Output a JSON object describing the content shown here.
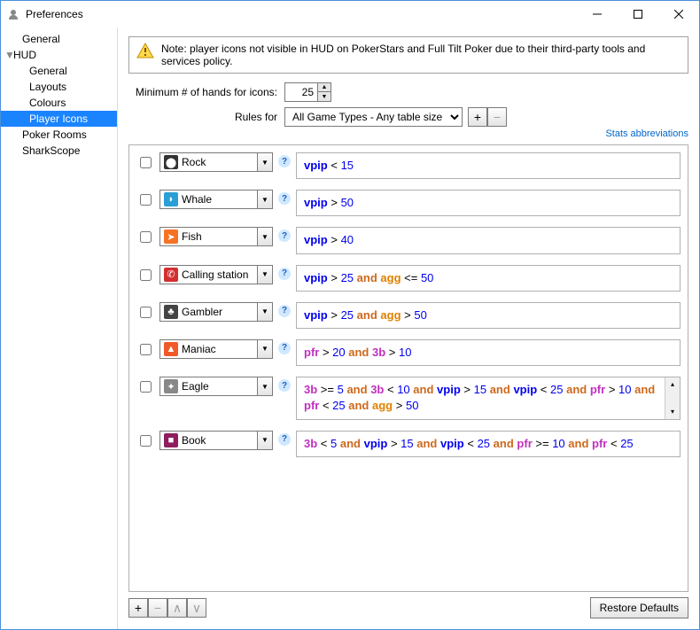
{
  "window": {
    "title": "Preferences"
  },
  "sidebar": {
    "items": [
      {
        "label": "General"
      },
      {
        "label": "HUD"
      },
      {
        "label": "General"
      },
      {
        "label": "Layouts"
      },
      {
        "label": "Colours"
      },
      {
        "label": "Player Icons"
      },
      {
        "label": "Poker Rooms"
      },
      {
        "label": "SharkScope"
      }
    ]
  },
  "note": "Note: player icons not visible in HUD on PokerStars and Full Tilt Poker due to their third-party tools and services policy.",
  "min_hands": {
    "label": "Minimum # of hands for icons:",
    "value": "25"
  },
  "rules_for": {
    "label": "Rules for",
    "selected": "All Game Types - Any table size"
  },
  "stats_link": "Stats abbreviations",
  "rules": [
    {
      "name": "Rock",
      "icon_bg": "#333333",
      "icon_glyph": "⬤"
    },
    {
      "name": "Whale",
      "icon_bg": "#2a9fd6",
      "icon_glyph": "◗"
    },
    {
      "name": "Fish",
      "icon_bg": "#f57224",
      "icon_glyph": "➤"
    },
    {
      "name": "Calling station",
      "icon_bg": "#d32f2f",
      "icon_glyph": "✆"
    },
    {
      "name": "Gambler",
      "icon_bg": "#444444",
      "icon_glyph": "♣"
    },
    {
      "name": "Maniac",
      "icon_bg": "#f05a28",
      "icon_glyph": "▲"
    },
    {
      "name": "Eagle",
      "icon_bg": "#888888",
      "icon_glyph": "✦"
    },
    {
      "name": "Book",
      "icon_bg": "#8e1e5f",
      "icon_glyph": "■"
    }
  ],
  "expressions": {
    "rock": [
      [
        "var",
        "vpip"
      ],
      [
        "op",
        " < "
      ],
      [
        "num",
        "15"
      ]
    ],
    "whale": [
      [
        "var",
        "vpip"
      ],
      [
        "op",
        " > "
      ],
      [
        "num",
        "50"
      ]
    ],
    "fish": [
      [
        "var",
        "vpip"
      ],
      [
        "op",
        " > "
      ],
      [
        "num",
        "40"
      ]
    ],
    "calling": [
      [
        "var",
        "vpip"
      ],
      [
        "op",
        " > "
      ],
      [
        "num",
        "25"
      ],
      [
        "txt",
        " "
      ],
      [
        "kw",
        "and"
      ],
      [
        "txt",
        " "
      ],
      [
        "agg",
        "agg"
      ],
      [
        "op",
        " <= "
      ],
      [
        "num",
        "50"
      ]
    ],
    "gambler": [
      [
        "var",
        "vpip"
      ],
      [
        "op",
        " > "
      ],
      [
        "num",
        "25"
      ],
      [
        "txt",
        " "
      ],
      [
        "kw",
        "and"
      ],
      [
        "txt",
        " "
      ],
      [
        "agg",
        "agg"
      ],
      [
        "op",
        " > "
      ],
      [
        "num",
        "50"
      ]
    ],
    "maniac": [
      [
        "pfr",
        "pfr"
      ],
      [
        "op",
        " > "
      ],
      [
        "num",
        "20"
      ],
      [
        "txt",
        " "
      ],
      [
        "kw",
        "and"
      ],
      [
        "txt",
        " "
      ],
      [
        "3b",
        "3b"
      ],
      [
        "op",
        " > "
      ],
      [
        "num",
        "10"
      ]
    ],
    "eagle": [
      [
        "3b",
        "3b"
      ],
      [
        "op",
        " >= "
      ],
      [
        "num",
        "5"
      ],
      [
        "txt",
        " "
      ],
      [
        "kw",
        "and"
      ],
      [
        "txt",
        " "
      ],
      [
        "3b",
        "3b"
      ],
      [
        "op",
        " < "
      ],
      [
        "num",
        "10"
      ],
      [
        "txt",
        " "
      ],
      [
        "kw",
        "and"
      ],
      [
        "txt",
        "  "
      ],
      [
        "var",
        "vpip"
      ],
      [
        "op",
        " > "
      ],
      [
        "num",
        "15"
      ],
      [
        "txt",
        " "
      ],
      [
        "kw",
        "and"
      ],
      [
        "txt",
        " "
      ],
      [
        "var",
        "vpip"
      ],
      [
        "op",
        " < "
      ],
      [
        "num",
        "25"
      ],
      [
        "txt",
        " "
      ],
      [
        "kw",
        "and"
      ],
      [
        "txt",
        " "
      ],
      [
        "pfr",
        "pfr"
      ],
      [
        "op",
        " > "
      ],
      [
        "num",
        "10"
      ],
      [
        "txt",
        " "
      ],
      [
        "kw",
        "and"
      ],
      [
        "txt",
        " "
      ],
      [
        "pfr",
        "pfr"
      ],
      [
        "op",
        " < "
      ],
      [
        "num",
        "25"
      ],
      [
        "txt",
        " "
      ],
      [
        "kw",
        "and"
      ],
      [
        "txt",
        " "
      ],
      [
        "agg",
        "agg"
      ],
      [
        "op",
        " > "
      ],
      [
        "num",
        "50"
      ]
    ],
    "book": [
      [
        "3b",
        "3b"
      ],
      [
        "op",
        " < "
      ],
      [
        "num",
        "5"
      ],
      [
        "txt",
        " "
      ],
      [
        "kw",
        "and"
      ],
      [
        "txt",
        " "
      ],
      [
        "var",
        "vpip"
      ],
      [
        "op",
        " > "
      ],
      [
        "num",
        "15"
      ],
      [
        "txt",
        " "
      ],
      [
        "kw",
        "and"
      ],
      [
        "txt",
        " "
      ],
      [
        "var",
        "vpip"
      ],
      [
        "op",
        " < "
      ],
      [
        "num",
        "25"
      ],
      [
        "txt",
        " "
      ],
      [
        "kw",
        "and"
      ],
      [
        "txt",
        " "
      ],
      [
        "pfr",
        "pfr"
      ],
      [
        "op",
        " >= "
      ],
      [
        "num",
        "10"
      ],
      [
        "txt",
        " "
      ],
      [
        "kw",
        "and"
      ],
      [
        "txt",
        " "
      ],
      [
        "pfr",
        "pfr"
      ],
      [
        "op",
        " < "
      ],
      [
        "num",
        "25"
      ]
    ]
  },
  "restore": "Restore Defaults"
}
